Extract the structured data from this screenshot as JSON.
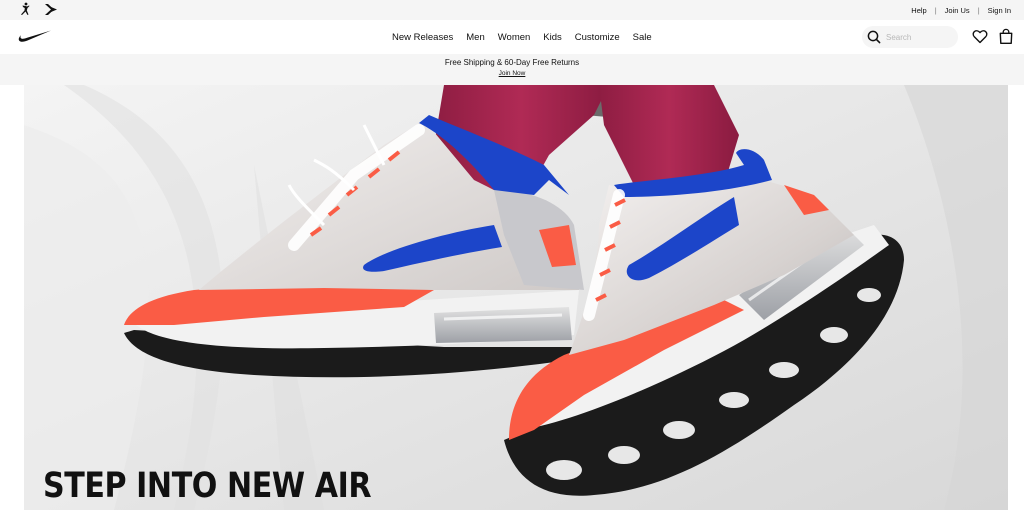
{
  "utility_bar": {
    "brand_icons": [
      "jordan-icon",
      "converse-icon"
    ],
    "links": [
      "Help",
      "Join Us",
      "Sign In"
    ],
    "separator": "|"
  },
  "header": {
    "logo": "nike-swoosh-icon",
    "nav": [
      "New Releases",
      "Men",
      "Women",
      "Kids",
      "Customize",
      "Sale"
    ],
    "search": {
      "placeholder": "Search",
      "value": ""
    },
    "icons": [
      "search-icon",
      "heart-icon",
      "bag-icon"
    ]
  },
  "promo": {
    "text": "Free Shipping & 60-Day Free Returns",
    "link": "Join Now"
  },
  "hero": {
    "headline": "STEP INTO NEW AIR"
  },
  "colors": {
    "utility_bg": "#f5f5f5",
    "shoe_orange": "#fa5c45",
    "shoe_blue": "#1c45c9",
    "socks": "#a8244e",
    "text": "#111111"
  }
}
